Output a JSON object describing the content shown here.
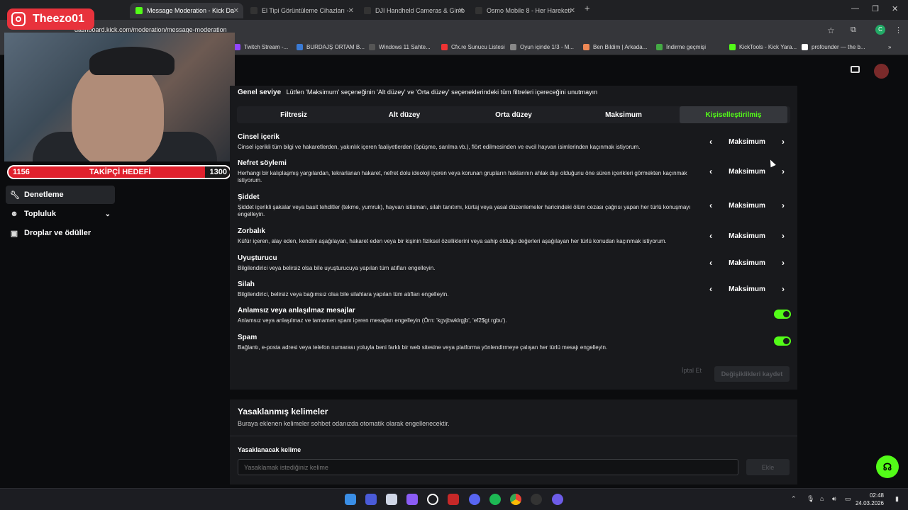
{
  "browser": {
    "tabs": [
      {
        "title": "Message Moderation - Kick Da",
        "active": true,
        "icon_color": "#53fc18"
      },
      {
        "title": "El Tipi Görüntüleme Cihazları -",
        "active": false,
        "icon_color": "#333"
      },
      {
        "title": "DJI Handheld Cameras & Gimb",
        "active": false,
        "icon_color": "#333"
      },
      {
        "title": "Osmo Mobile 8 - Her Hareketi",
        "active": false,
        "icon_color": "#333"
      }
    ],
    "new_tab": "+",
    "url": "dashboard.kick.com/moderation/message-moderation",
    "bookmarks": [
      {
        "label": "Twitch Stream -...",
        "color": "#9146ff"
      },
      {
        "label": "BURDAJŞ ORTAM B...",
        "color": "#3a7bd5"
      },
      {
        "label": "Windows 11 Sahte...",
        "color": "#555"
      },
      {
        "label": "Cfx.re Sunucu Listesi",
        "color": "#e33"
      },
      {
        "label": "Oyun içinde 1/3 - M...",
        "color": "#888"
      },
      {
        "label": "Ben Bildim | Arkada...",
        "color": "#e85"
      },
      {
        "label": "İndirme geçmişi",
        "color": "#4a4"
      },
      {
        "label": "KickTools - Kick Yara...",
        "color": "#53fc18"
      },
      {
        "label": "profounder — the b...",
        "color": "#fff"
      }
    ]
  },
  "overlay": {
    "streamer_name": "Theezo01",
    "goal_current": "1156",
    "goal_label": "TAKİPÇİ HEDEFİ",
    "goal_target": "1300",
    "goal_progress": 0.889
  },
  "sidebar": {
    "items": [
      {
        "label": "Denetleme",
        "icon": "wrench-icon",
        "active": true
      },
      {
        "label": "Topluluk",
        "icon": "users-icon",
        "active": false
      },
      {
        "label": "Droplar ve ödüller",
        "icon": "gift-icon",
        "active": false
      }
    ]
  },
  "moderation": {
    "general_label": "Genel seviye",
    "general_note": "Lütfen 'Maksimum' seçeneğinin 'Alt düzey' ve 'Orta düzey' seçeneklerindeki tüm filtreleri içereceğini unutmayın",
    "levels": [
      "Filtresiz",
      "Alt düzey",
      "Orta düzey",
      "Maksimum",
      "Kişiselleştirilmiş"
    ],
    "selected_level": "Kişiselleştirilmiş",
    "rules": [
      {
        "title": "Cinsel içerik",
        "desc": "Cinsel içerikli tüm bilgi ve hakaretlerden, yakınlık içeren faaliyetlerden (öpüşme, sarılma vb.), flört edilmesinden ve evcil hayvan isimlerinden kaçınmak istiyorum.",
        "value": "Maksimum"
      },
      {
        "title": "Nefret söylemi",
        "desc": "Herhangi bir kalıplaşmış yargılardan, tekrarlanan hakaret, nefret dolu ideoloji içeren veya korunan grupların haklarının ahlak dışı olduğunu öne süren içerikleri görmekten kaçınmak istiyorum.",
        "value": "Maksimum"
      },
      {
        "title": "Şiddet",
        "desc": "Şiddet içerikli şakalar veya basit tehditler (tekme, yumruk), hayvan istismarı, silah tanıtımı, kürtaj veya yasal düzenlemeler haricindeki ölüm cezası çağrısı yapan her türlü konuşmayı engelleyin.",
        "value": "Maksimum"
      },
      {
        "title": "Zorbalık",
        "desc": "Küfür içeren, alay eden, kendini aşağılayan, hakaret eden veya bir kişinin fiziksel özelliklerini veya sahip olduğu değerleri aşağılayan her türlü konudan kaçınmak istiyorum.",
        "value": "Maksimum"
      },
      {
        "title": "Uyuşturucu",
        "desc": "Bilgilendirici veya belirsiz olsa bile uyuşturucuya yapılan tüm atıfları engelleyin.",
        "value": "Maksimum"
      },
      {
        "title": "Silah",
        "desc": "Bilgilendirici, belirsiz veya bağımsız olsa bile silahlara yapılan tüm atıfları engelleyin.",
        "value": "Maksimum"
      }
    ],
    "toggles": [
      {
        "title": "Anlamsız veya anlaşılmaz mesajlar",
        "desc": "Anlamsız veya anlaşılmaz ve tamamen spam içeren mesajları engelleyin (Örn: 'kgvjbwklrgjb', 'ef2$gt rgbu').",
        "on": true
      },
      {
        "title": "Spam",
        "desc": "Bağlantı, e-posta adresi veya telefon numarası yoluyla beni farklı bir web sitesine veya platforma yönlendirmeye çalışan her türlü mesajı engelleyin.",
        "on": true
      }
    ],
    "cancel_label": "İptal Et",
    "save_label": "Değişiklikleri kaydet"
  },
  "banned_words": {
    "title": "Yasaklanmış kelimeler",
    "subtitle": "Buraya eklenen kelimeler sohbet odanızda otomatik olarak engellenecektir.",
    "field_label": "Yasaklanacak kelime",
    "placeholder": "Yasaklamak istediğiniz kelime",
    "add_label": "Ekle"
  },
  "taskbar": {
    "time": "02:48",
    "date": "24.03.2026"
  },
  "colors": {
    "accent": "#53fc18",
    "goal_red": "#e0212d",
    "panel": "#18191c"
  }
}
